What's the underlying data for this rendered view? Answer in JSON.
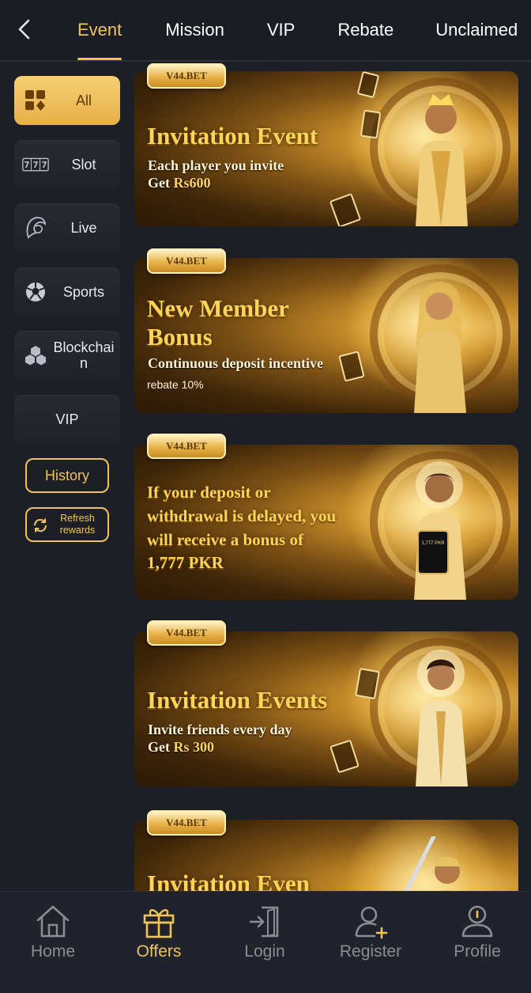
{
  "tabs": [
    {
      "label": "Event",
      "active": true
    },
    {
      "label": "Mission"
    },
    {
      "label": "VIP"
    },
    {
      "label": "Rebate"
    },
    {
      "label": "Unclaimed"
    }
  ],
  "sidebar": {
    "categories": [
      {
        "label": "All",
        "icon": "cards-icon",
        "active": true
      },
      {
        "label": "Slot",
        "icon": "slot-777-icon"
      },
      {
        "label": "Live",
        "icon": "live-woman-icon"
      },
      {
        "label": "Sports",
        "icon": "soccer-ball-icon"
      },
      {
        "label": "Blockchain",
        "icon": "blockchain-cubes-icon"
      },
      {
        "label": "VIP",
        "icon": ""
      }
    ],
    "history_label": "History",
    "refresh_label": "Refresh rewards"
  },
  "banners": [
    {
      "badge": "V44.BET",
      "title": "Invitation Event",
      "line1": "Each player you invite",
      "line2_prefix": "Get ",
      "line2_highlight": "Rs600"
    },
    {
      "badge": "V44.BET",
      "title_line1": "New Member",
      "title_line2": "Bonus",
      "line1": "Continuous deposit incentive",
      "small": "rebate 10%"
    },
    {
      "badge": "V44.BET",
      "lines": [
        "If your deposit or",
        "withdrawal is delayed, you",
        "will receive a bonus of",
        "1,777 PKR"
      ],
      "phone_text": "1,777 PKR"
    },
    {
      "badge": "V44.BET",
      "title": "Invitation Events",
      "line1": "Invite friends every day",
      "line2_prefix": "Get ",
      "line2_highlight": "Rs 300"
    },
    {
      "badge": "V44.BET",
      "title": "Invitation Even"
    }
  ],
  "bottom_nav": [
    {
      "label": "Home",
      "icon": "home-icon"
    },
    {
      "label": "Offers",
      "icon": "gift-icon",
      "active": true
    },
    {
      "label": "Login",
      "icon": "login-door-icon"
    },
    {
      "label": "Register",
      "icon": "user-add-icon"
    },
    {
      "label": "Profile",
      "icon": "profile-icon"
    }
  ],
  "colors": {
    "accent": "#f2c35a",
    "background": "#1c1f26",
    "nav_inactive": "#8a8d95"
  }
}
